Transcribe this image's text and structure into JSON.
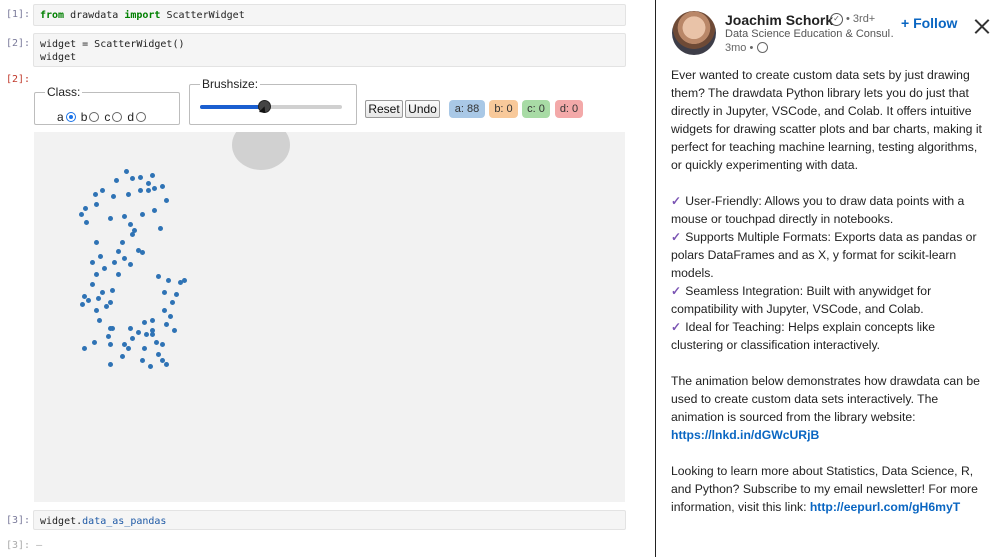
{
  "notebook": {
    "cells": [
      {
        "prompt": "[1]:",
        "code_parts": [
          {
            "t": "from",
            "cls": "kw"
          },
          {
            "t": " drawdata ",
            "cls": ""
          },
          {
            "t": "import",
            "cls": "kw"
          },
          {
            "t": " ScatterWidget",
            "cls": ""
          }
        ]
      },
      {
        "prompt": "[2]:",
        "line1": "widget = ScatterWidget()",
        "line2": "widget"
      },
      {
        "out_prompt": "[2]:"
      },
      {
        "prompt": "[3]:",
        "code_parts": [
          {
            "t": "widget.",
            "cls": ""
          },
          {
            "t": "data_as_pandas",
            "cls": "attr"
          }
        ]
      },
      {
        "prompt": "[3]:",
        "placeholder": "—"
      }
    ],
    "widget": {
      "class_legend": "Class:",
      "class_options": [
        "a",
        "b",
        "c",
        "d"
      ],
      "class_selected": "a",
      "brush_legend": "Brushsize:",
      "brush_level": 0.45,
      "reset_label": "Reset",
      "undo_label": "Undo",
      "badges": [
        {
          "label": "a: 88",
          "color": "#a9c8e6"
        },
        {
          "label": "b: 0",
          "color": "#f8c99a"
        },
        {
          "label": "c: 0",
          "color": "#a8dba5"
        },
        {
          "label": "d: 0",
          "color": "#f3a9a9"
        }
      ],
      "point_color": "#2f73b5",
      "canvas_bg": "#f2f2f2"
    }
  },
  "post": {
    "author": "Joachim Schork",
    "degree": "• 3rd+",
    "headline": "Data Science Education & Consul…",
    "time": "3mo •",
    "follow_label": "+ Follow",
    "follow_color": "#0a66c2",
    "check_color": "#7a54b3",
    "intro": "Ever wanted to create custom data sets by just drawing them? The drawdata Python library lets you do just that directly in Jupyter, VSCode, and Colab. It offers intuitive widgets for drawing scatter plots and bar charts, making it perfect for teaching machine learning, testing algorithms, or quickly experimenting with data.",
    "features": [
      "User-Friendly: Allows you to draw data points with a mouse or touchpad directly in notebooks.",
      "Supports Multiple Formats: Exports data as pandas or polars DataFrames and as X, y format for scikit-learn models.",
      "Seamless Integration: Built with anywidget for compatibility with Jupyter, VSCode, and Colab.",
      "Ideal for Teaching: Helps explain concepts like clustering or classification interactively."
    ],
    "anim_text": "The animation below demonstrates how drawdata can be used to create custom data sets interactively. The animation is sourced from the library website: ",
    "anim_link": "https://lnkd.in/dGWcURjB",
    "cta_text": "Looking to learn more about Statistics, Data Science, R, and Python? Subscribe to my email newsletter! For more information, visit this link: ",
    "cta_link": "http://eepurl.com/gH6myT"
  }
}
